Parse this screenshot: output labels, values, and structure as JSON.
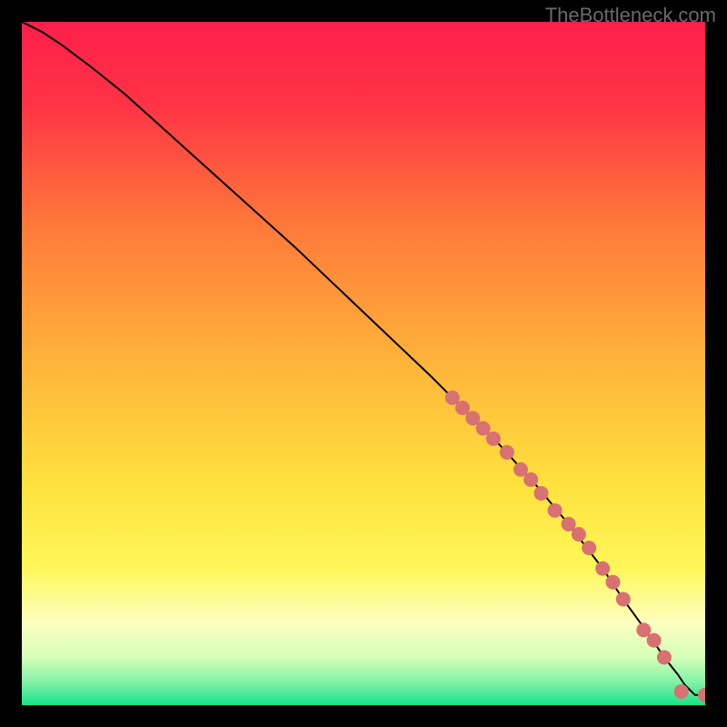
{
  "watermark": "TheBottleneck.com",
  "chart_data": {
    "type": "line",
    "title": "",
    "xlabel": "",
    "ylabel": "",
    "xlim": [
      0,
      100
    ],
    "ylim": [
      0,
      100
    ],
    "background_gradient": {
      "stops": [
        {
          "pos": 0.0,
          "color": "#ff1f4b"
        },
        {
          "pos": 0.12,
          "color": "#ff3346"
        },
        {
          "pos": 0.3,
          "color": "#ff7a3a"
        },
        {
          "pos": 0.5,
          "color": "#ffb43a"
        },
        {
          "pos": 0.68,
          "color": "#ffe23e"
        },
        {
          "pos": 0.8,
          "color": "#fff75a"
        },
        {
          "pos": 0.88,
          "color": "#fdffc0"
        },
        {
          "pos": 0.93,
          "color": "#d4ffb8"
        },
        {
          "pos": 0.965,
          "color": "#86f2a8"
        },
        {
          "pos": 1.0,
          "color": "#17e38a"
        }
      ]
    },
    "curve": {
      "x": [
        0,
        3,
        6,
        10,
        15,
        20,
        30,
        40,
        50,
        60,
        66,
        70,
        75,
        80,
        85,
        88,
        92,
        94,
        96,
        97,
        98.5,
        100
      ],
      "y": [
        100,
        98.5,
        96.5,
        93.5,
        89.5,
        85,
        76,
        67,
        57.5,
        48,
        42,
        38,
        32.5,
        26.5,
        20,
        15.5,
        10,
        7,
        4.5,
        3,
        1.5,
        1.5
      ]
    },
    "scatter": {
      "x": [
        63,
        64.5,
        66,
        67.5,
        69,
        71,
        73,
        74.5,
        76,
        78,
        80,
        81.5,
        83,
        85,
        86.5,
        88,
        91,
        92.5,
        94,
        96.5,
        100
      ],
      "y": [
        45,
        43.5,
        42,
        40.5,
        39,
        37,
        34.5,
        33,
        31,
        28.5,
        26.5,
        25,
        23,
        20,
        18,
        15.5,
        11,
        9.5,
        7,
        2,
        1.5
      ],
      "color": "#d87171",
      "radius": 8
    }
  }
}
